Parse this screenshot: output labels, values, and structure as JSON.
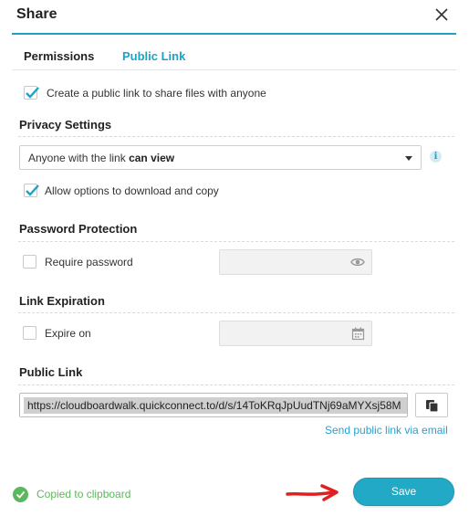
{
  "dialog": {
    "title": "Share",
    "close_icon": "close-icon"
  },
  "tabs": [
    {
      "label": "Permissions",
      "active": false
    },
    {
      "label": "Public Link",
      "active": true
    }
  ],
  "create_link": {
    "label": "Create a public link to share files with anyone",
    "checked": true
  },
  "privacy": {
    "heading": "Privacy Settings",
    "select_prefix": "Anyone with the link ",
    "select_bold": "can view",
    "info_icon": "info-icon",
    "allow_download_label": "Allow options to download and copy",
    "allow_download_checked": true
  },
  "password": {
    "heading": "Password Protection",
    "require_label": "Require password",
    "checked": false,
    "field_value": "",
    "field_icon": "eye-icon"
  },
  "expiration": {
    "heading": "Link Expiration",
    "expire_label": "Expire on",
    "checked": false,
    "field_value": "",
    "field_icon": "calendar-icon"
  },
  "public_link": {
    "heading": "Public Link",
    "url": "https://cloudboardwalk.quickconnect.to/d/s/14ToKRqJpUudTNj69aMYXsj58M",
    "copy_icon": "copy-icon",
    "send_label": "Send public link via email"
  },
  "footer": {
    "toast_text": "Copied to clipboard",
    "toast_icon": "check-circle-icon",
    "save_label": "Save"
  },
  "colors": {
    "accent": "#19a3c7",
    "save_button": "#21a9c5",
    "success": "#5cb85c",
    "annotation_arrow": "#e02020"
  }
}
